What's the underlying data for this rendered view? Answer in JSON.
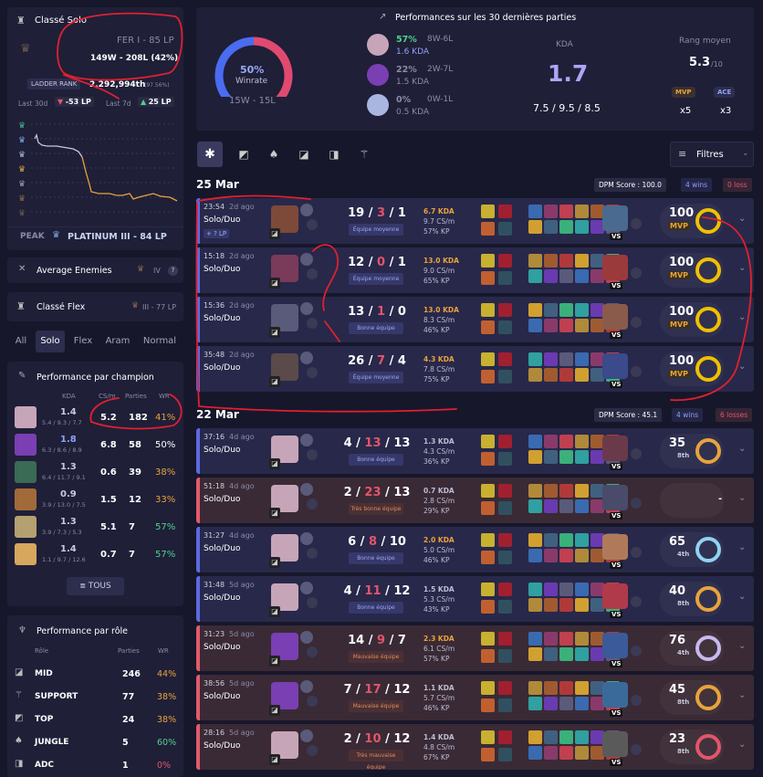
{
  "ranked_solo": {
    "title": "Classé Solo",
    "rank": "FER I - 85 LP",
    "record": "149W - 208L (42%)",
    "ladder_label": "LADDER RANK",
    "ladder_value": "2,292,994th",
    "ladder_pct": "(97.56%)",
    "last30_label": "Last 30d",
    "last30_value": "-53 LP",
    "last7_label": "Last 7d",
    "last7_value": "25 LP",
    "peak_label": "PEAK",
    "peak_value": "PLATINUM III - 84 LP"
  },
  "average_enemies": {
    "label": "Average Enemies",
    "value": "IV",
    "help": "?"
  },
  "ranked_flex": {
    "title": "Classé Flex",
    "value": "III - 77 LP"
  },
  "queue_tabs": [
    "All",
    "Solo",
    "Flex",
    "Aram",
    "Normal"
  ],
  "champion_perf": {
    "title": "Performance par champion",
    "headers": [
      "KDA",
      "CS/m",
      "Parties",
      "WR"
    ],
    "rows": [
      {
        "kda": "1.4",
        "kda_detail": "5.4 / 9.3 / 7.7",
        "cs": "5.2",
        "games": "182",
        "wr": "41%",
        "wr_color": "#e8a33c",
        "kda_color": "#c9c9dc",
        "color": "#c7a5b8"
      },
      {
        "kda": "1.8",
        "kda_detail": "6.3 / 8.6 / 8.9",
        "cs": "6.8",
        "games": "58",
        "wr": "50%",
        "wr_color": "#ffffff",
        "kda_color": "#8ea3f5",
        "color": "#7a3fb3"
      },
      {
        "kda": "1.3",
        "kda_detail": "6.4 / 11.7 / 9.1",
        "cs": "0.6",
        "games": "39",
        "wr": "38%",
        "wr_color": "#e8a33c",
        "kda_color": "#c9c9dc",
        "color": "#3a6b55"
      },
      {
        "kda": "0.9",
        "kda_detail": "3.9 / 13.0 / 7.5",
        "cs": "1.5",
        "games": "12",
        "wr": "33%",
        "wr_color": "#e8a33c",
        "kda_color": "#c9c9dc",
        "color": "#a26a38"
      },
      {
        "kda": "1.3",
        "kda_detail": "3.9 / 7.3 / 5.3",
        "cs": "5.1",
        "games": "7",
        "wr": "57%",
        "wr_color": "#4fd18b",
        "kda_color": "#c9c9dc",
        "color": "#b4a070"
      },
      {
        "kda": "1.4",
        "kda_detail": "1.1 / 9.7 / 12.6",
        "cs": "0.7",
        "games": "7",
        "wr": "57%",
        "wr_color": "#4fd18b",
        "kda_color": "#c9c9dc",
        "color": "#d6a75c"
      }
    ],
    "all_button": "TOUS"
  },
  "role_perf": {
    "title": "Performance par rôle",
    "headers": [
      "Rôle",
      "Parties",
      "WR"
    ],
    "rows": [
      {
        "role": "MID",
        "games": "246",
        "wr": "44%",
        "wr_color": "#e8a33c"
      },
      {
        "role": "SUPPORT",
        "games": "77",
        "wr": "38%",
        "wr_color": "#e8a33c"
      },
      {
        "role": "TOP",
        "games": "24",
        "wr": "38%",
        "wr_color": "#e8a33c"
      },
      {
        "role": "JUNGLE",
        "games": "5",
        "wr": "60%",
        "wr_color": "#4fd18b"
      },
      {
        "role": "ADC",
        "games": "1",
        "wr": "0%",
        "wr_color": "#e2556b"
      }
    ]
  },
  "summary": {
    "title": "Performances sur les 30 dernières parties",
    "winrate_pct": "50%",
    "winrate_fraction": 0.5,
    "winrate_label": "Winrate",
    "wl": "15W - 15L",
    "champs": [
      {
        "wr": "57%",
        "wl": "8W-6L",
        "kda": "1.6 KDA",
        "wr_color": "#4fd18b",
        "kda_color": "#8ea3f5",
        "color": "#c7a5b8"
      },
      {
        "wr": "22%",
        "wl": "2W-7L",
        "kda": "1.5 KDA",
        "wr_color": "#8b8ba8",
        "kda_color": "#8b8ba8",
        "color": "#7a3fb3"
      },
      {
        "wr": "0%",
        "wl": "0W-1L",
        "kda": "0.5 KDA",
        "wr_color": "#8b8ba8",
        "kda_color": "#8b8ba8",
        "color": "#a9b7e0"
      }
    ],
    "kda_label": "KDA",
    "kda_value": "1.7",
    "kda_detail": "7.5 / 9.5 / 8.5",
    "rank_label": "Rang moyen",
    "rank_value": "5.3",
    "rank_of": "/10",
    "mvp_label": "MVP",
    "mvp_count": "x5",
    "ace_label": "ACE",
    "ace_count": "x3"
  },
  "filters": {
    "label": "Filtres"
  },
  "day_groups": [
    {
      "date": "25 Mar",
      "dpm": "DPM Score : 100.0",
      "wins": "4 wins",
      "losses": "0 loss"
    },
    {
      "date": "22 Mar",
      "dpm": "DPM Score : 45.1",
      "wins": "4 wins",
      "losses": "6 losses"
    }
  ],
  "games": [
    {
      "result": "win",
      "duration": "23:54",
      "ago": "2d ago",
      "queue": "Solo/Duo",
      "lp": "+ ? LP",
      "k": "19",
      "d": "3",
      "a": "1",
      "team": "Équipe moyenne",
      "team_kind": "ok",
      "kda": "6.7 KDA",
      "cs": "9.7 CS/m",
      "kp": "57% KP",
      "kda_color": "#e8a33c",
      "score": "100",
      "score_sub": "MVP",
      "ring_color": "#f0c000",
      "champ": "#7d4a3a",
      "enemy": "#4a6a8f"
    },
    {
      "result": "win",
      "duration": "15:18",
      "ago": "2d ago",
      "queue": "Solo/Duo",
      "lp": "",
      "k": "12",
      "d": "0",
      "a": "1",
      "team": "Équipe moyenne",
      "team_kind": "ok",
      "kda": "13.0 KDA",
      "cs": "9.0 CS/m",
      "kp": "65% KP",
      "kda_color": "#e8a33c",
      "score": "100",
      "score_sub": "MVP",
      "ring_color": "#f0c000",
      "champ": "#7a3a5a",
      "enemy": "#9a3a3a"
    },
    {
      "result": "win",
      "duration": "15:36",
      "ago": "2d ago",
      "queue": "Solo/Duo",
      "lp": "",
      "k": "13",
      "d": "1",
      "a": "0",
      "team": "Bonne équipe",
      "team_kind": "ok",
      "kda": "13.0 KDA",
      "cs": "8.3 CS/m",
      "kp": "46% KP",
      "kda_color": "#e8a33c",
      "score": "100",
      "score_sub": "MVP",
      "ring_color": "#f0c000",
      "champ": "#5a5a7a",
      "enemy": "#8a5a4a"
    },
    {
      "result": "win",
      "duration": "35:48",
      "ago": "2d ago",
      "queue": "Solo/Duo",
      "lp": "",
      "k": "26",
      "d": "7",
      "a": "4",
      "team": "Équipe moyenne",
      "team_kind": "ok",
      "kda": "4.3 KDA",
      "cs": "7.8 CS/m",
      "kp": "75% KP",
      "kda_color": "#e8a33c",
      "score": "100",
      "score_sub": "MVP",
      "ring_color": "#f0c000",
      "champ": "#5a4a4a",
      "enemy": "#3a4a8a"
    },
    {
      "result": "win",
      "duration": "37:16",
      "ago": "4d ago",
      "queue": "Solo/Duo",
      "lp": "",
      "k": "4",
      "d": "13",
      "a": "13",
      "team": "Bonne équipe",
      "team_kind": "ok",
      "kda": "1.3 KDA",
      "cs": "4.3 CS/m",
      "kp": "36% KP",
      "kda_color": "#bdbdd4",
      "score": "35",
      "score_sub": "8th",
      "ring_color": "#e8a33c",
      "champ": "#c7a5b8",
      "enemy": "#6a3a4a"
    },
    {
      "result": "loss",
      "duration": "51:18",
      "ago": "4d ago",
      "queue": "Solo/Duo",
      "lp": "",
      "k": "2",
      "d": "23",
      "a": "13",
      "team": "Très bonne équipe",
      "team_kind": "bad",
      "kda": "0.7 KDA",
      "cs": "2.8 CS/m",
      "kp": "29% KP",
      "kda_color": "#bdbdd4",
      "score": "-",
      "score_sub": "",
      "ring_color": "",
      "champ": "#c7a5b8",
      "enemy": "#4a4a6a"
    },
    {
      "result": "win",
      "duration": "31:27",
      "ago": "4d ago",
      "queue": "Solo/Duo",
      "lp": "",
      "k": "6",
      "d": "8",
      "a": "10",
      "team": "Bonne équipe",
      "team_kind": "ok",
      "kda": "2.0 KDA",
      "cs": "5.0 CS/m",
      "kp": "46% KP",
      "kda_color": "#e8a33c",
      "score": "65",
      "score_sub": "4th",
      "ring_color": "#8fd3f0",
      "champ": "#c7a5b8",
      "enemy": "#b07a5a"
    },
    {
      "result": "win",
      "duration": "31:48",
      "ago": "5d ago",
      "queue": "Solo/Duo",
      "lp": "",
      "k": "4",
      "d": "11",
      "a": "12",
      "team": "Bonne équipe",
      "team_kind": "ok",
      "kda": "1.5 KDA",
      "cs": "5.3 CS/m",
      "kp": "43% KP",
      "kda_color": "#bdbdd4",
      "score": "40",
      "score_sub": "8th",
      "ring_color": "#e8a33c",
      "champ": "#c7a5b8",
      "enemy": "#b03a4a"
    },
    {
      "result": "loss",
      "duration": "31:23",
      "ago": "5d ago",
      "queue": "Solo/Duo",
      "lp": "",
      "k": "14",
      "d": "9",
      "a": "7",
      "team": "Mauvaise équipe",
      "team_kind": "bad",
      "kda": "2.3 KDA",
      "cs": "6.1 CS/m",
      "kp": "57% KP",
      "kda_color": "#e8a33c",
      "score": "76",
      "score_sub": "4th",
      "ring_color": "#c8b8f0",
      "champ": "#7a3fb3",
      "enemy": "#3a5a9a"
    },
    {
      "result": "loss",
      "duration": "38:56",
      "ago": "5d ago",
      "queue": "Solo/Duo",
      "lp": "",
      "k": "7",
      "d": "17",
      "a": "12",
      "team": "Mauvaise équipe",
      "team_kind": "bad",
      "kda": "1.1 KDA",
      "cs": "5.7 CS/m",
      "kp": "46% KP",
      "kda_color": "#bdbdd4",
      "score": "45",
      "score_sub": "8th",
      "ring_color": "#e8a33c",
      "champ": "#7a3fb3",
      "enemy": "#3a6a9a"
    },
    {
      "result": "loss",
      "duration": "28:16",
      "ago": "5d ago",
      "queue": "Solo/Duo",
      "lp": "",
      "k": "2",
      "d": "10",
      "a": "12",
      "team": "Très mauvaise équipe",
      "team_kind": "bad",
      "kda": "1.4 KDA",
      "cs": "4.8 CS/m",
      "kp": "67% KP",
      "kda_color": "#bdbdd4",
      "score": "23",
      "score_sub": "8th",
      "ring_color": "#e2556b",
      "champ": "#c7a5b8",
      "enemy": "#5a5a5a"
    }
  ],
  "colors": {
    "accent": "#6d7fea",
    "gold": "#e8a33c",
    "win_bar": "#5b6be0",
    "loss_bar": "#e05b6b",
    "annotation": "#e0202f"
  }
}
